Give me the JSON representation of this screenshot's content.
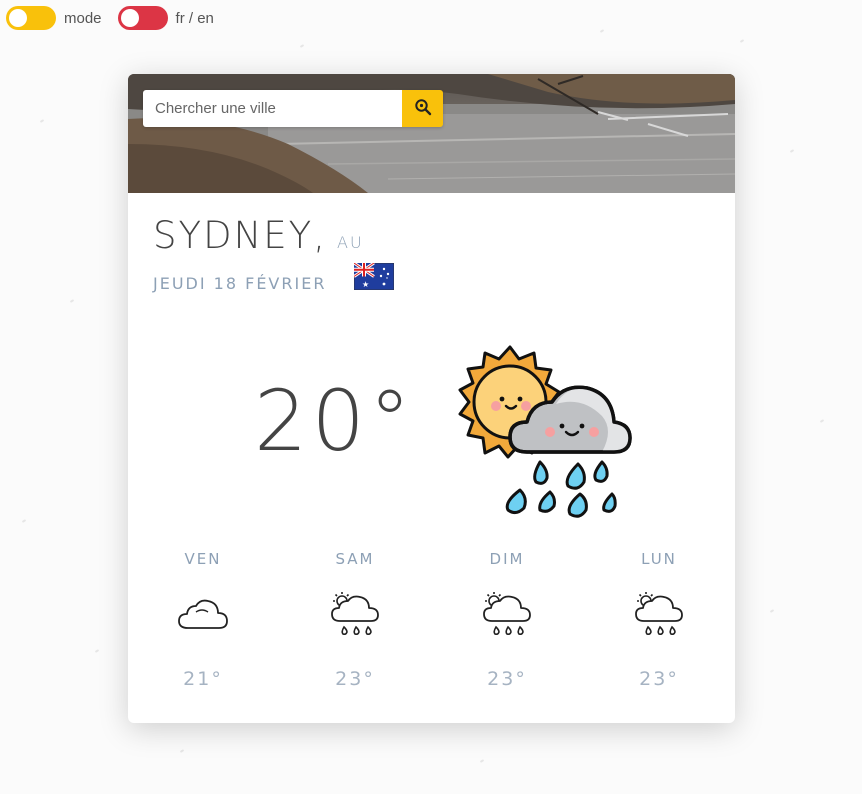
{
  "toggles": {
    "mode_label": "mode",
    "mode_color": "#f9c10b",
    "lang_label": "fr / en",
    "lang_color": "#dc3545"
  },
  "search": {
    "placeholder": "Chercher une ville",
    "value": "",
    "button_icon": "search-icon",
    "button_color": "#f9c10b"
  },
  "location": {
    "city": "SYDNEY,",
    "country": "AU",
    "date": "JEUDI 18 FÉVRIER",
    "flag_icon": "australia-flag-icon"
  },
  "current": {
    "temperature": "20°",
    "icon": "sun-cloud-rain-icon"
  },
  "forecast": [
    {
      "day": "VEN",
      "temp": "21°",
      "icon": "cloud-icon"
    },
    {
      "day": "SAM",
      "temp": "23°",
      "icon": "sun-cloud-rain-icon"
    },
    {
      "day": "DIM",
      "temp": "23°",
      "icon": "sun-cloud-rain-icon"
    },
    {
      "day": "LUN",
      "temp": "23°",
      "icon": "sun-cloud-rain-icon"
    }
  ]
}
